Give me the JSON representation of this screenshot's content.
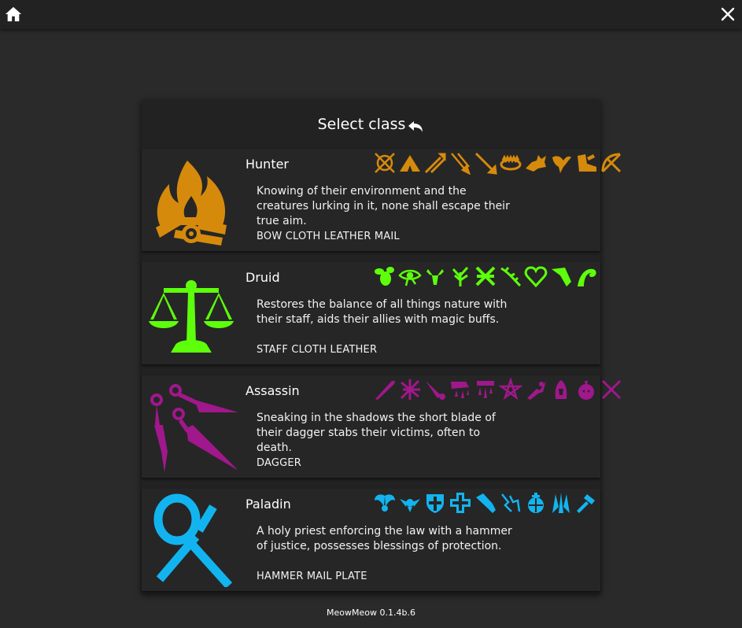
{
  "topbar": {
    "home_icon": "home-icon",
    "close_icon": "close-icon"
  },
  "panel": {
    "title": "Select class",
    "back_icon": "undo-arrow-icon"
  },
  "classes": [
    {
      "name": "Hunter",
      "description": "Knowing of their environment and the creatures lurking in it, none shall escape their true aim.",
      "gear": "BOW CLOTH LEATHER MAIL",
      "color": "#d68a0c",
      "emblem": "campfire-icon",
      "skills": [
        "crosshair-skill-icon",
        "tent-skill-icon",
        "arrow-volley-skill-icon",
        "arrow-rain-skill-icon",
        "arrow-skill-icon",
        "bear-trap-skill-icon",
        "wolf-skill-icon",
        "bird-skill-icon",
        "boot-skill-icon",
        "bow-skill-icon"
      ]
    },
    {
      "name": "Druid",
      "description": "Restores the balance of all things nature with their staff, aids their allies with magic buffs.",
      "gear": "STAFF CLOTH LEATHER",
      "color": "#5dff0b",
      "emblem": "scales-icon",
      "skills": [
        "bee-skill-icon",
        "eye-skill-icon",
        "stag-skill-icon",
        "tree-skill-icon",
        "thorns-skill-icon",
        "vine-skill-icon",
        "heart-skill-icon",
        "claw-skill-icon",
        "wave-skill-icon"
      ]
    },
    {
      "name": "Assassin",
      "description": "Sneaking in the shadows the short blade of their dagger stabs their victims, often to death.",
      "gear": "DAGGER",
      "color": "#a1178c",
      "emblem": "kunai-icon",
      "skills": [
        "blade-skill-icon",
        "slash-skill-icon",
        "stab-skill-icon",
        "bleed-skill-icon",
        "poison-skill-icon",
        "pentagram-skill-icon",
        "dash-skill-icon",
        "hood-skill-icon",
        "bomb-skill-icon",
        "crossed-daggers-skill-icon"
      ]
    },
    {
      "name": "Paladin",
      "description": "A holy priest enforcing the law with a hammer of justice, possesses blessings of protection.",
      "gear": "HAMMER MAIL PLATE",
      "color": "#12b4ef",
      "emblem": "ankh-icon",
      "skills": [
        "angel-wings-skill-icon",
        "winged-emblem-skill-icon",
        "templar-shield-skill-icon",
        "holy-cross-skill-icon",
        "gauntlet-skill-icon",
        "lightning-hand-skill-icon",
        "orb-skill-icon",
        "holy-burst-skill-icon",
        "hammer-skill-icon"
      ]
    }
  ],
  "footer": {
    "version": "MeowMeow 0.1.4b.6"
  }
}
